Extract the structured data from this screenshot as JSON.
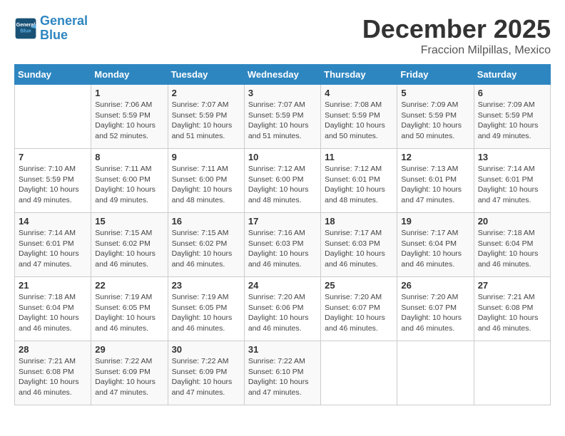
{
  "header": {
    "logo_line1": "General",
    "logo_line2": "Blue",
    "month": "December 2025",
    "location": "Fraccion Milpillas, Mexico"
  },
  "weekdays": [
    "Sunday",
    "Monday",
    "Tuesday",
    "Wednesday",
    "Thursday",
    "Friday",
    "Saturday"
  ],
  "weeks": [
    [
      {
        "day": "",
        "info": ""
      },
      {
        "day": "1",
        "info": "Sunrise: 7:06 AM\nSunset: 5:59 PM\nDaylight: 10 hours\nand 52 minutes."
      },
      {
        "day": "2",
        "info": "Sunrise: 7:07 AM\nSunset: 5:59 PM\nDaylight: 10 hours\nand 51 minutes."
      },
      {
        "day": "3",
        "info": "Sunrise: 7:07 AM\nSunset: 5:59 PM\nDaylight: 10 hours\nand 51 minutes."
      },
      {
        "day": "4",
        "info": "Sunrise: 7:08 AM\nSunset: 5:59 PM\nDaylight: 10 hours\nand 50 minutes."
      },
      {
        "day": "5",
        "info": "Sunrise: 7:09 AM\nSunset: 5:59 PM\nDaylight: 10 hours\nand 50 minutes."
      },
      {
        "day": "6",
        "info": "Sunrise: 7:09 AM\nSunset: 5:59 PM\nDaylight: 10 hours\nand 49 minutes."
      }
    ],
    [
      {
        "day": "7",
        "info": "Sunrise: 7:10 AM\nSunset: 5:59 PM\nDaylight: 10 hours\nand 49 minutes."
      },
      {
        "day": "8",
        "info": "Sunrise: 7:11 AM\nSunset: 6:00 PM\nDaylight: 10 hours\nand 49 minutes."
      },
      {
        "day": "9",
        "info": "Sunrise: 7:11 AM\nSunset: 6:00 PM\nDaylight: 10 hours\nand 48 minutes."
      },
      {
        "day": "10",
        "info": "Sunrise: 7:12 AM\nSunset: 6:00 PM\nDaylight: 10 hours\nand 48 minutes."
      },
      {
        "day": "11",
        "info": "Sunrise: 7:12 AM\nSunset: 6:01 PM\nDaylight: 10 hours\nand 48 minutes."
      },
      {
        "day": "12",
        "info": "Sunrise: 7:13 AM\nSunset: 6:01 PM\nDaylight: 10 hours\nand 47 minutes."
      },
      {
        "day": "13",
        "info": "Sunrise: 7:14 AM\nSunset: 6:01 PM\nDaylight: 10 hours\nand 47 minutes."
      }
    ],
    [
      {
        "day": "14",
        "info": "Sunrise: 7:14 AM\nSunset: 6:01 PM\nDaylight: 10 hours\nand 47 minutes."
      },
      {
        "day": "15",
        "info": "Sunrise: 7:15 AM\nSunset: 6:02 PM\nDaylight: 10 hours\nand 46 minutes."
      },
      {
        "day": "16",
        "info": "Sunrise: 7:15 AM\nSunset: 6:02 PM\nDaylight: 10 hours\nand 46 minutes."
      },
      {
        "day": "17",
        "info": "Sunrise: 7:16 AM\nSunset: 6:03 PM\nDaylight: 10 hours\nand 46 minutes."
      },
      {
        "day": "18",
        "info": "Sunrise: 7:17 AM\nSunset: 6:03 PM\nDaylight: 10 hours\nand 46 minutes."
      },
      {
        "day": "19",
        "info": "Sunrise: 7:17 AM\nSunset: 6:04 PM\nDaylight: 10 hours\nand 46 minutes."
      },
      {
        "day": "20",
        "info": "Sunrise: 7:18 AM\nSunset: 6:04 PM\nDaylight: 10 hours\nand 46 minutes."
      }
    ],
    [
      {
        "day": "21",
        "info": "Sunrise: 7:18 AM\nSunset: 6:04 PM\nDaylight: 10 hours\nand 46 minutes."
      },
      {
        "day": "22",
        "info": "Sunrise: 7:19 AM\nSunset: 6:05 PM\nDaylight: 10 hours\nand 46 minutes."
      },
      {
        "day": "23",
        "info": "Sunrise: 7:19 AM\nSunset: 6:05 PM\nDaylight: 10 hours\nand 46 minutes."
      },
      {
        "day": "24",
        "info": "Sunrise: 7:20 AM\nSunset: 6:06 PM\nDaylight: 10 hours\nand 46 minutes."
      },
      {
        "day": "25",
        "info": "Sunrise: 7:20 AM\nSunset: 6:07 PM\nDaylight: 10 hours\nand 46 minutes."
      },
      {
        "day": "26",
        "info": "Sunrise: 7:20 AM\nSunset: 6:07 PM\nDaylight: 10 hours\nand 46 minutes."
      },
      {
        "day": "27",
        "info": "Sunrise: 7:21 AM\nSunset: 6:08 PM\nDaylight: 10 hours\nand 46 minutes."
      }
    ],
    [
      {
        "day": "28",
        "info": "Sunrise: 7:21 AM\nSunset: 6:08 PM\nDaylight: 10 hours\nand 46 minutes."
      },
      {
        "day": "29",
        "info": "Sunrise: 7:22 AM\nSunset: 6:09 PM\nDaylight: 10 hours\nand 47 minutes."
      },
      {
        "day": "30",
        "info": "Sunrise: 7:22 AM\nSunset: 6:09 PM\nDaylight: 10 hours\nand 47 minutes."
      },
      {
        "day": "31",
        "info": "Sunrise: 7:22 AM\nSunset: 6:10 PM\nDaylight: 10 hours\nand 47 minutes."
      },
      {
        "day": "",
        "info": ""
      },
      {
        "day": "",
        "info": ""
      },
      {
        "day": "",
        "info": ""
      }
    ]
  ]
}
